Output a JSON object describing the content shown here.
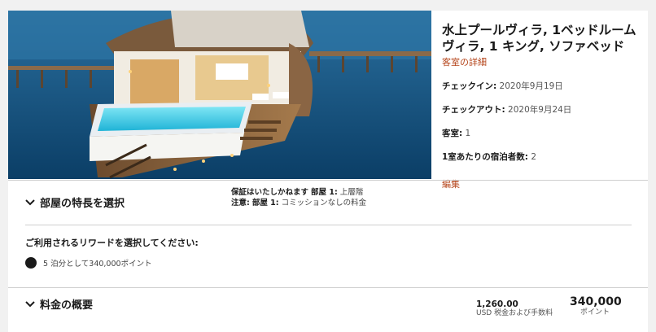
{
  "room": {
    "title": "水上プールヴィラ, 1ベッドルーム ヴィラ, 1 キング, ソファベッド",
    "details_link": "客室の詳細",
    "checkin_label": "チェックイン:",
    "checkin_value": "2020年9月19日",
    "checkout_label": "チェックアウト:",
    "checkout_value": "2020年9月24日",
    "rooms_label": "客室:",
    "rooms_value": "1",
    "guests_label": "1室あたりの宿泊者数:",
    "guests_value": "2",
    "edit_link": "編集"
  },
  "features": {
    "title": "部屋の特長を選択",
    "guarantee_label": "保証はいたしかねます",
    "guarantee_room": "部屋 1:",
    "guarantee_value": "上層階",
    "note_label": "注意:",
    "note_room": "部屋 1:",
    "note_value": "コミッションなしの料金"
  },
  "rewards": {
    "title": "ご利用されるリワードを選択してください:",
    "option_label": "5 泊分として340,000ポイント"
  },
  "summary": {
    "title": "料金の概要",
    "amount": "1,260.00",
    "amount_sub": "USD 税金および手数料",
    "points": "340,000",
    "points_unit": "ポイント"
  },
  "colors": {
    "accent": "#b5451b",
    "sea": "#0f5a8f"
  }
}
